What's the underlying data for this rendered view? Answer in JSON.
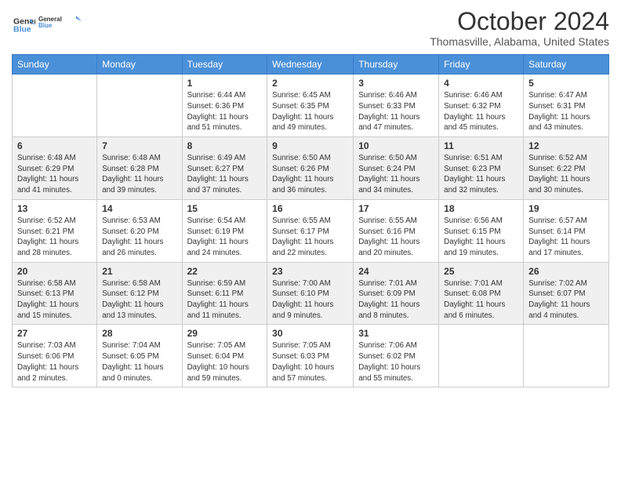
{
  "logo": {
    "line1": "General",
    "line2": "Blue",
    "icon_color": "#4a90d9"
  },
  "title": "October 2024",
  "location": "Thomasville, Alabama, United States",
  "days_of_week": [
    "Sunday",
    "Monday",
    "Tuesday",
    "Wednesday",
    "Thursday",
    "Friday",
    "Saturday"
  ],
  "weeks": [
    [
      {
        "day": "",
        "info": ""
      },
      {
        "day": "",
        "info": ""
      },
      {
        "day": "1",
        "info": "Sunrise: 6:44 AM\nSunset: 6:36 PM\nDaylight: 11 hours and 51 minutes."
      },
      {
        "day": "2",
        "info": "Sunrise: 6:45 AM\nSunset: 6:35 PM\nDaylight: 11 hours and 49 minutes."
      },
      {
        "day": "3",
        "info": "Sunrise: 6:46 AM\nSunset: 6:33 PM\nDaylight: 11 hours and 47 minutes."
      },
      {
        "day": "4",
        "info": "Sunrise: 6:46 AM\nSunset: 6:32 PM\nDaylight: 11 hours and 45 minutes."
      },
      {
        "day": "5",
        "info": "Sunrise: 6:47 AM\nSunset: 6:31 PM\nDaylight: 11 hours and 43 minutes."
      }
    ],
    [
      {
        "day": "6",
        "info": "Sunrise: 6:48 AM\nSunset: 6:29 PM\nDaylight: 11 hours and 41 minutes."
      },
      {
        "day": "7",
        "info": "Sunrise: 6:48 AM\nSunset: 6:28 PM\nDaylight: 11 hours and 39 minutes."
      },
      {
        "day": "8",
        "info": "Sunrise: 6:49 AM\nSunset: 6:27 PM\nDaylight: 11 hours and 37 minutes."
      },
      {
        "day": "9",
        "info": "Sunrise: 6:50 AM\nSunset: 6:26 PM\nDaylight: 11 hours and 36 minutes."
      },
      {
        "day": "10",
        "info": "Sunrise: 6:50 AM\nSunset: 6:24 PM\nDaylight: 11 hours and 34 minutes."
      },
      {
        "day": "11",
        "info": "Sunrise: 6:51 AM\nSunset: 6:23 PM\nDaylight: 11 hours and 32 minutes."
      },
      {
        "day": "12",
        "info": "Sunrise: 6:52 AM\nSunset: 6:22 PM\nDaylight: 11 hours and 30 minutes."
      }
    ],
    [
      {
        "day": "13",
        "info": "Sunrise: 6:52 AM\nSunset: 6:21 PM\nDaylight: 11 hours and 28 minutes."
      },
      {
        "day": "14",
        "info": "Sunrise: 6:53 AM\nSunset: 6:20 PM\nDaylight: 11 hours and 26 minutes."
      },
      {
        "day": "15",
        "info": "Sunrise: 6:54 AM\nSunset: 6:19 PM\nDaylight: 11 hours and 24 minutes."
      },
      {
        "day": "16",
        "info": "Sunrise: 6:55 AM\nSunset: 6:17 PM\nDaylight: 11 hours and 22 minutes."
      },
      {
        "day": "17",
        "info": "Sunrise: 6:55 AM\nSunset: 6:16 PM\nDaylight: 11 hours and 20 minutes."
      },
      {
        "day": "18",
        "info": "Sunrise: 6:56 AM\nSunset: 6:15 PM\nDaylight: 11 hours and 19 minutes."
      },
      {
        "day": "19",
        "info": "Sunrise: 6:57 AM\nSunset: 6:14 PM\nDaylight: 11 hours and 17 minutes."
      }
    ],
    [
      {
        "day": "20",
        "info": "Sunrise: 6:58 AM\nSunset: 6:13 PM\nDaylight: 11 hours and 15 minutes."
      },
      {
        "day": "21",
        "info": "Sunrise: 6:58 AM\nSunset: 6:12 PM\nDaylight: 11 hours and 13 minutes."
      },
      {
        "day": "22",
        "info": "Sunrise: 6:59 AM\nSunset: 6:11 PM\nDaylight: 11 hours and 11 minutes."
      },
      {
        "day": "23",
        "info": "Sunrise: 7:00 AM\nSunset: 6:10 PM\nDaylight: 11 hours and 9 minutes."
      },
      {
        "day": "24",
        "info": "Sunrise: 7:01 AM\nSunset: 6:09 PM\nDaylight: 11 hours and 8 minutes."
      },
      {
        "day": "25",
        "info": "Sunrise: 7:01 AM\nSunset: 6:08 PM\nDaylight: 11 hours and 6 minutes."
      },
      {
        "day": "26",
        "info": "Sunrise: 7:02 AM\nSunset: 6:07 PM\nDaylight: 11 hours and 4 minutes."
      }
    ],
    [
      {
        "day": "27",
        "info": "Sunrise: 7:03 AM\nSunset: 6:06 PM\nDaylight: 11 hours and 2 minutes."
      },
      {
        "day": "28",
        "info": "Sunrise: 7:04 AM\nSunset: 6:05 PM\nDaylight: 11 hours and 0 minutes."
      },
      {
        "day": "29",
        "info": "Sunrise: 7:05 AM\nSunset: 6:04 PM\nDaylight: 10 hours and 59 minutes."
      },
      {
        "day": "30",
        "info": "Sunrise: 7:05 AM\nSunset: 6:03 PM\nDaylight: 10 hours and 57 minutes."
      },
      {
        "day": "31",
        "info": "Sunrise: 7:06 AM\nSunset: 6:02 PM\nDaylight: 10 hours and 55 minutes."
      },
      {
        "day": "",
        "info": ""
      },
      {
        "day": "",
        "info": ""
      }
    ]
  ]
}
